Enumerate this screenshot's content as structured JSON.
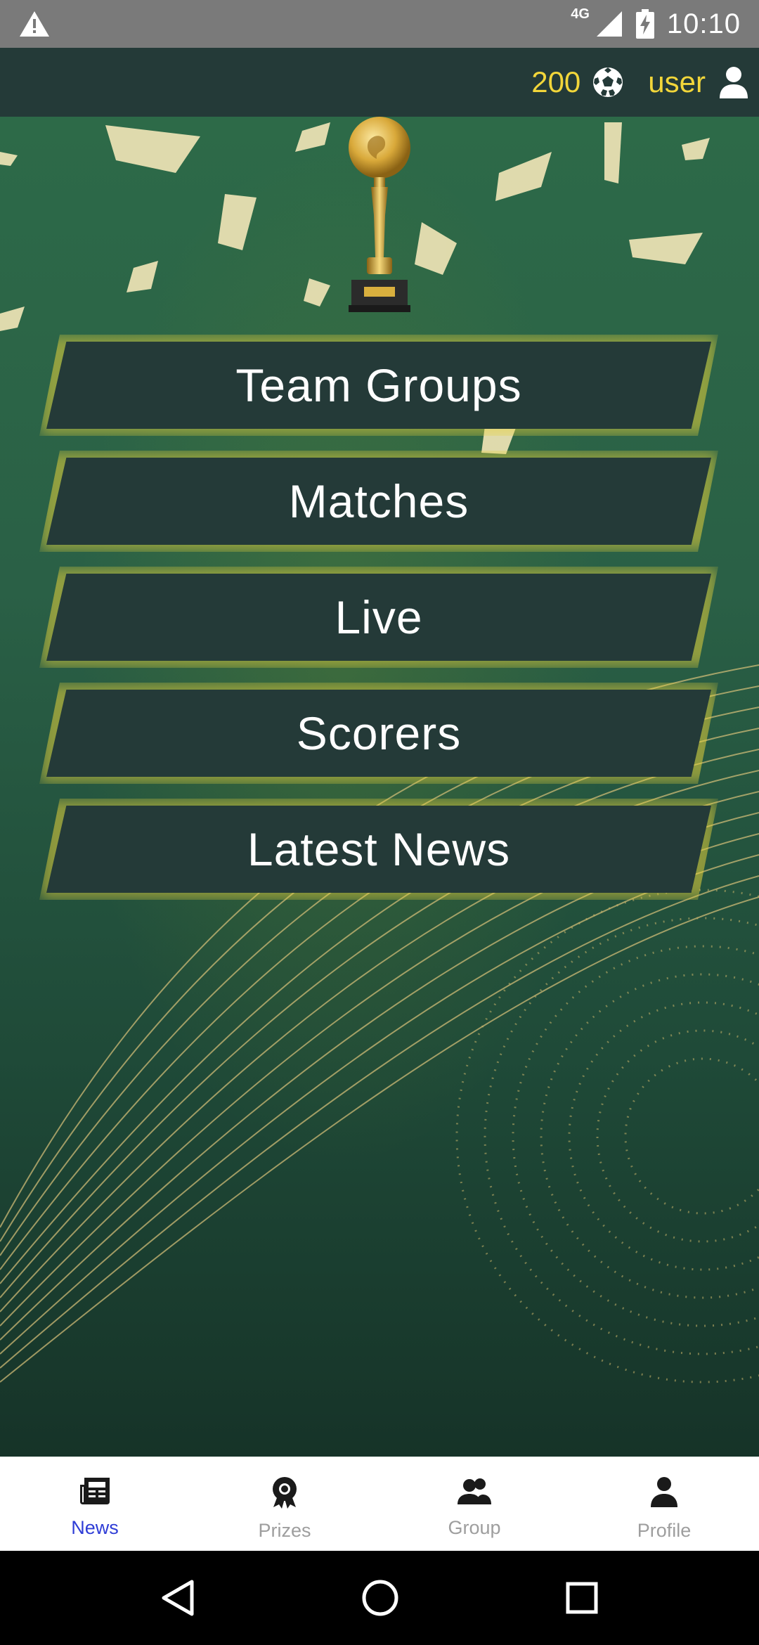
{
  "status_bar": {
    "network": "4G",
    "time": "10:10"
  },
  "header": {
    "coins": "200",
    "coin_icon": "soccer-ball-icon",
    "username": "user",
    "user_icon": "person-icon"
  },
  "menu": {
    "items": [
      {
        "label": "Team Groups"
      },
      {
        "label": "Matches"
      },
      {
        "label": "Live"
      },
      {
        "label": "Scorers"
      },
      {
        "label": "Latest News"
      }
    ]
  },
  "bottom_nav": {
    "items": [
      {
        "label": "News",
        "icon": "newspaper-icon",
        "active": true
      },
      {
        "label": "Prizes",
        "icon": "award-icon",
        "active": false
      },
      {
        "label": "Group",
        "icon": "group-icon",
        "active": false
      },
      {
        "label": "Profile",
        "icon": "person-icon",
        "active": false
      }
    ]
  },
  "colors": {
    "accent_yellow": "#f2d63a",
    "header_bg": "#243a38",
    "active_nav": "#2f3dd6",
    "inactive_nav": "#9e9e9e"
  }
}
